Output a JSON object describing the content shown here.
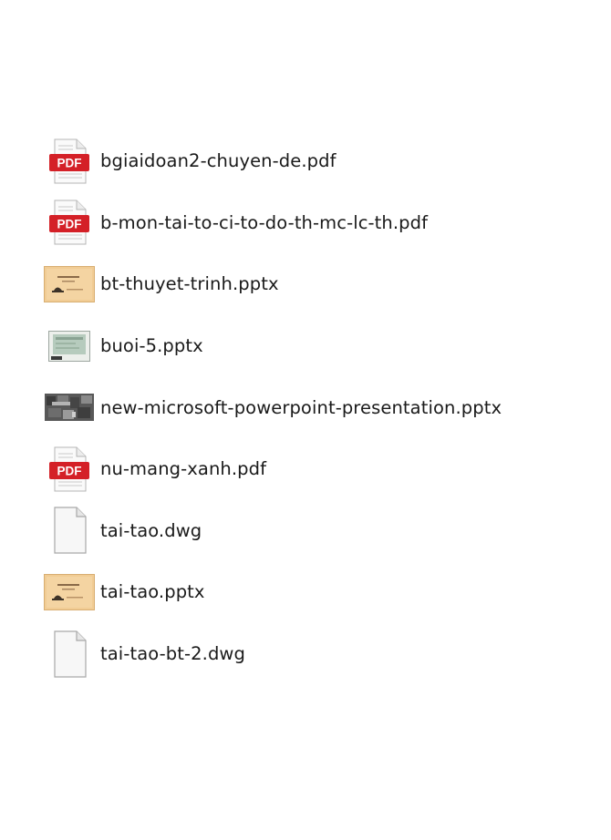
{
  "files": [
    {
      "name": "bgiaidoan2-chuyen-de.pdf",
      "icon": "pdf-icon"
    },
    {
      "name": "b-mon-tai-to-ci-to-do-th-mc-lc-th.pdf",
      "icon": "pdf-icon"
    },
    {
      "name": "bt-thuyet-trinh.pptx",
      "icon": "pptx-thumbnail-icon"
    },
    {
      "name": "buoi-5.pptx",
      "icon": "pptx-thumbnail-icon"
    },
    {
      "name": "new-microsoft-powerpoint-presentation.pptx",
      "icon": "pptx-thumbnail-icon"
    },
    {
      "name": "nu-mang-xanh.pdf",
      "icon": "pdf-icon"
    },
    {
      "name": "tai-tao.dwg",
      "icon": "blank-file-icon"
    },
    {
      "name": "tai-tao.pptx",
      "icon": "pptx-thumbnail-icon"
    },
    {
      "name": "tai-tao-bt-2.dwg",
      "icon": "blank-file-icon"
    }
  ],
  "pdf_badge_text": "PDF",
  "colors": {
    "pdf_red": "#d42027",
    "text": "#1a1a1a",
    "background": "#ffffff"
  }
}
